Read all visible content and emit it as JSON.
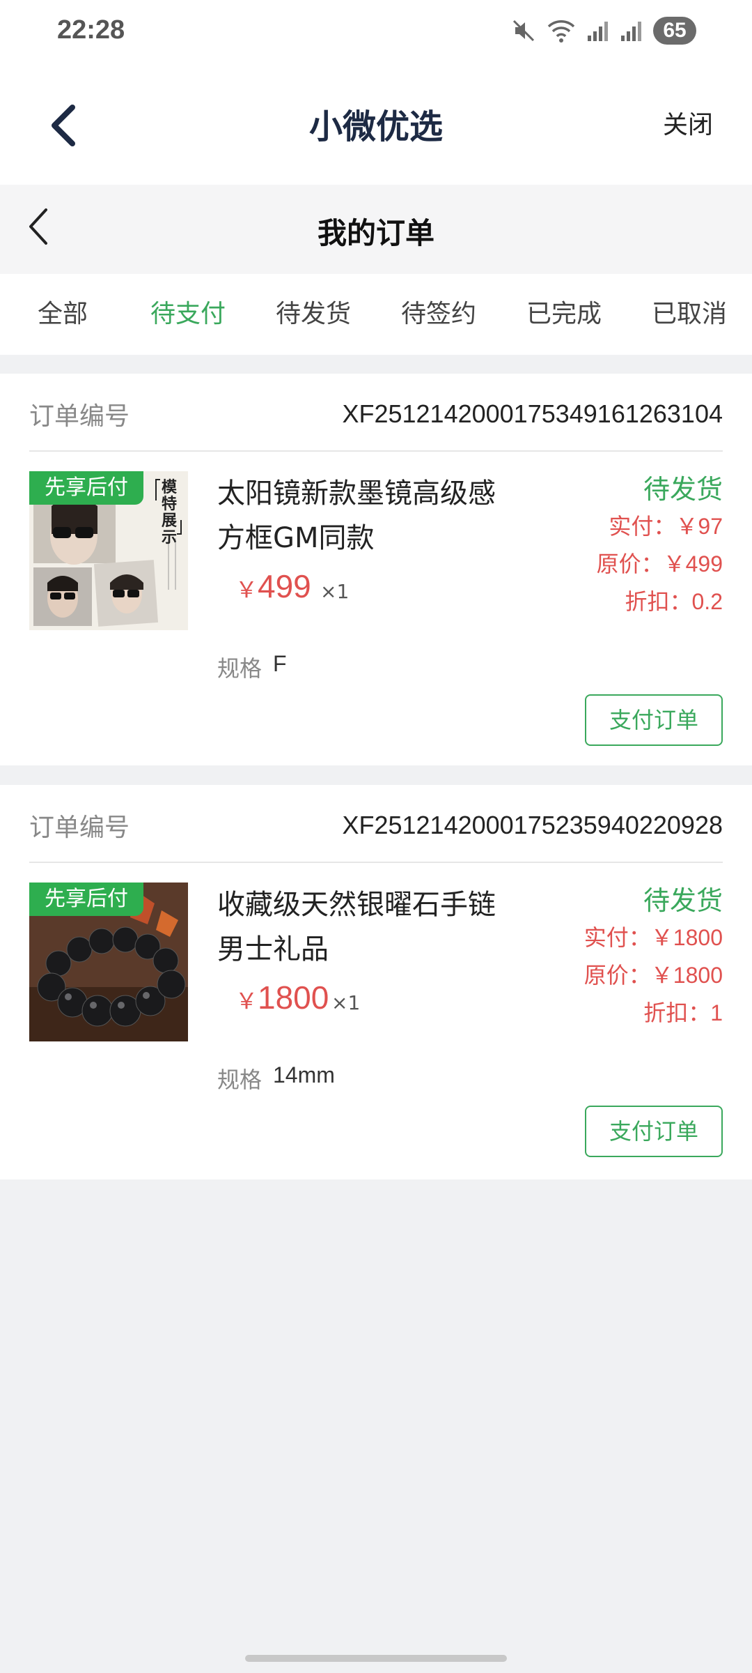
{
  "status_bar": {
    "time": "22:28",
    "battery": "65"
  },
  "app_bar": {
    "title": "小微优选",
    "close_label": "关闭"
  },
  "page_header": {
    "title": "我的订单"
  },
  "tabs": [
    {
      "label": "全部",
      "active": false
    },
    {
      "label": "待支付",
      "active": true
    },
    {
      "label": "待发货",
      "active": false
    },
    {
      "label": "待签约",
      "active": false
    },
    {
      "label": "已完成",
      "active": false
    },
    {
      "label": "已取消",
      "active": false
    }
  ],
  "orders": [
    {
      "order_label": "订单编号",
      "order_number": "XF2512142000175349161263104",
      "badge": "先享后付",
      "image_text": [
        "模",
        "特",
        "展",
        "示"
      ],
      "name_line1": "太阳镜新款墨镜高级感",
      "name_line2": "方框GM同款",
      "currency": "￥",
      "price": "499",
      "qty": "×1",
      "spec_label": "规格",
      "spec_value": "F",
      "status": "待发货",
      "paid": "实付：￥97",
      "original": "原价：￥499",
      "discount": "折扣：0.2",
      "button": "支付订单"
    },
    {
      "order_label": "订单编号",
      "order_number": "XF2512142000175235940220928",
      "badge": "先享后付",
      "name_line1": "收藏级天然银曜石手链",
      "name_line2": "男士礼品",
      "currency": "￥",
      "price": "1800",
      "qty": "×1",
      "spec_label": "规格",
      "spec_value": "14mm",
      "status": "待发货",
      "paid": "实付：￥1800",
      "original": "原价：￥1800",
      "discount": "折扣：1",
      "button": "支付订单"
    }
  ],
  "colors": {
    "accent": "#3aa85c",
    "price": "#e0514f",
    "badge": "#2eae4f"
  }
}
